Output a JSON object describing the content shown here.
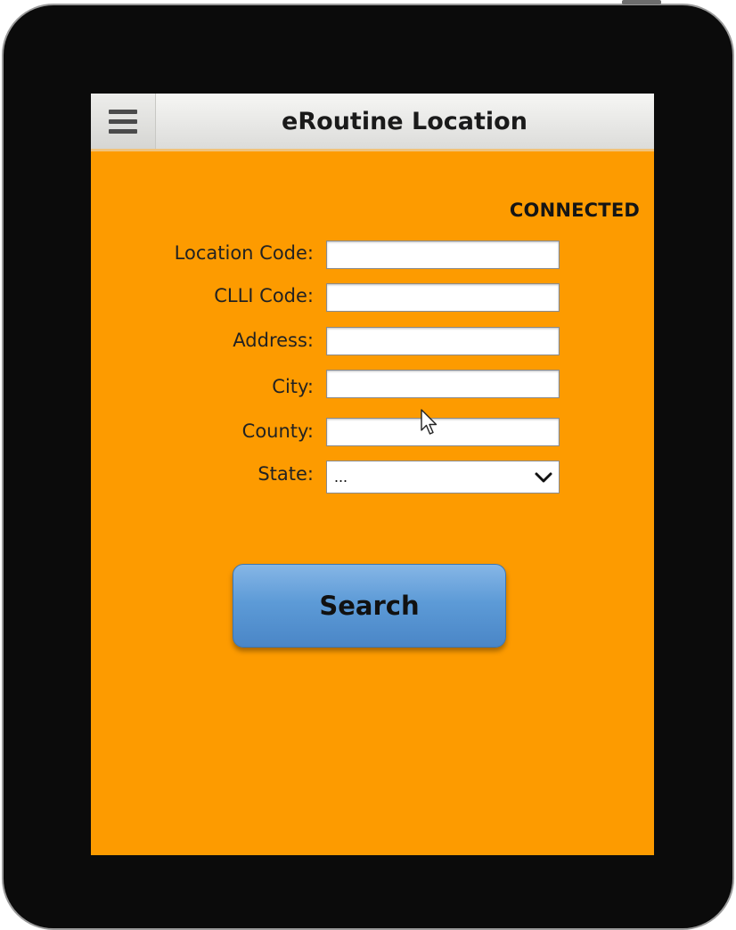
{
  "header": {
    "title": "eRoutine Location",
    "menu_icon": "hamburger-menu-icon"
  },
  "status": {
    "text": "CONNECTED"
  },
  "form": {
    "location_code": {
      "label": "Location Code:",
      "value": ""
    },
    "clli_code": {
      "label": "CLLI Code:",
      "value": ""
    },
    "address": {
      "label": "Address:",
      "value": ""
    },
    "city": {
      "label": "City:",
      "value": ""
    },
    "county": {
      "label": "County:",
      "value": ""
    },
    "state": {
      "label": "State:",
      "selected": "...",
      "icon": "chevron-down-icon"
    }
  },
  "actions": {
    "search_label": "Search"
  },
  "colors": {
    "screen_background": "#fd9b00",
    "button": "#5d9bd7",
    "header": "#e6e6e4"
  }
}
